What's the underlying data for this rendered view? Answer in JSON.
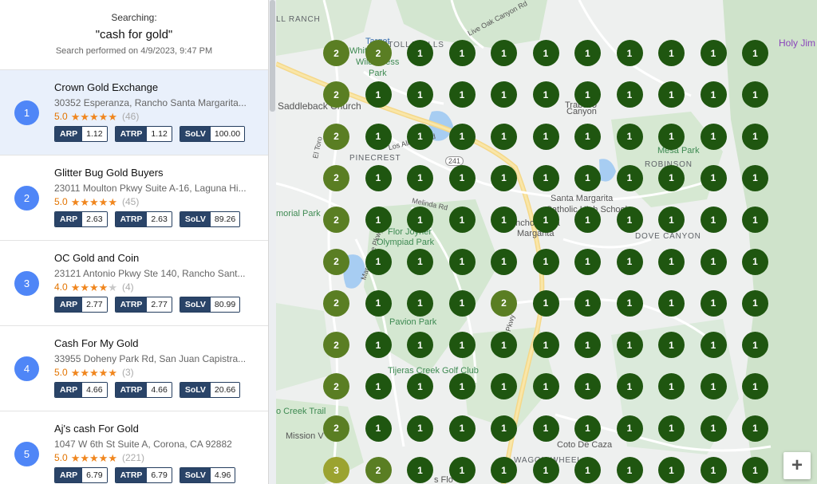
{
  "search": {
    "label": "Searching:",
    "query": "\"cash for gold\"",
    "performed": "Search performed on 4/9/2023, 9:47 PM"
  },
  "results": [
    {
      "rank": "1",
      "name": "Crown Gold Exchange",
      "address": "30352 Esperanza, Rancho Santa Margarita...",
      "rating": "5.0",
      "stars": 5,
      "reviews": "(46)",
      "arp": "1.12",
      "atrp": "1.12",
      "solv": "100.00",
      "selected": true
    },
    {
      "rank": "2",
      "name": "Glitter Bug Gold Buyers",
      "address": "23011 Moulton Pkwy Suite A-16, Laguna Hi...",
      "rating": "5.0",
      "stars": 5,
      "reviews": "(45)",
      "arp": "2.63",
      "atrp": "2.63",
      "solv": "89.26",
      "selected": false
    },
    {
      "rank": "3",
      "name": "OC Gold and Coin",
      "address": "23121 Antonio Pkwy Ste 140, Rancho Sant...",
      "rating": "4.0",
      "stars": 4,
      "reviews": "(4)",
      "arp": "2.77",
      "atrp": "2.77",
      "solv": "80.99",
      "selected": false
    },
    {
      "rank": "4",
      "name": "Cash For My Gold",
      "address": "33955 Doheny Park Rd, San Juan Capistra...",
      "rating": "5.0",
      "stars": 5,
      "reviews": "(3)",
      "arp": "4.66",
      "atrp": "4.66",
      "solv": "20.66",
      "selected": false
    },
    {
      "rank": "5",
      "name": "Aj's cash For Gold",
      "address": "1047 W 6th St Suite A, Corona, CA 92882",
      "rating": "5.0",
      "stars": 5,
      "reviews": "(221)",
      "arp": "6.79",
      "atrp": "6.79",
      "solv": "4.96",
      "selected": false
    }
  ],
  "metric_labels": {
    "arp": "ARP",
    "atrp": "ATRP",
    "solv": "SoLV"
  },
  "map": {
    "labels": {
      "ranch": "LL RANCH",
      "target": "Target",
      "whiting": "Whiting",
      "wilderness": "Wilderness",
      "park": "Park",
      "saddleback": "Saddleback Church",
      "pinecrest": "PINECREST",
      "trabuco": "Trabuco",
      "canyon": "Canyon",
      "mesa_park": "Mesa Park",
      "robinson": "ROBINSON",
      "santa_margarita": "Santa Margarita",
      "catholic": "Catholic High School",
      "rancho_santa": "ancho Santa",
      "margarita": "Margarita",
      "memorial_park": "morial Park",
      "flor_joyner": "Flor Joyner",
      "olympiad": "Olympiad Park",
      "dove_canyon": "DOVE CANYON",
      "pavion": "Pavion Park",
      "tijeras": "Tijeras Creek Golf Club",
      "creek_trail": "o Creek Trail",
      "mission": "Mission V",
      "coto": "Coto De Caza",
      "wagon": "WAGON WHEEL",
      "holy_jim": "Holy Jim",
      "live_oak": "Live Oak Canyon Rd",
      "road_241": "241",
      "los_alisos": "Los Alisos Blvd",
      "melinda": "Melinda Rd",
      "marguerite": "Marguerite Pkwy",
      "antonio": "Antonio Pkwy",
      "el_toro": "El Toro",
      "tortolla": "ORTOLLA HILLS",
      "florence": "s Flo"
    },
    "grid_rows": [
      [
        "2",
        "2",
        "1",
        "1",
        "1",
        "1",
        "1",
        "1",
        "1",
        "1",
        "1"
      ],
      [
        "2",
        "1",
        "1",
        "1",
        "1",
        "1",
        "1",
        "1",
        "1",
        "1",
        "1"
      ],
      [
        "2",
        "1",
        "1",
        "1",
        "1",
        "1",
        "1",
        "1",
        "1",
        "1",
        "1"
      ],
      [
        "2",
        "1",
        "1",
        "1",
        "1",
        "1",
        "1",
        "1",
        "1",
        "1",
        "1"
      ],
      [
        "2",
        "1",
        "1",
        "1",
        "1",
        "1",
        "1",
        "1",
        "1",
        "1",
        "1"
      ],
      [
        "2",
        "1",
        "1",
        "1",
        "1",
        "1",
        "1",
        "1",
        "1",
        "1",
        "1"
      ],
      [
        "2",
        "1",
        "1",
        "1",
        "2",
        "1",
        "1",
        "1",
        "1",
        "1",
        "1"
      ],
      [
        "2",
        "1",
        "1",
        "1",
        "1",
        "1",
        "1",
        "1",
        "1",
        "1",
        "1"
      ],
      [
        "2",
        "1",
        "1",
        "1",
        "1",
        "1",
        "1",
        "1",
        "1",
        "1",
        "1"
      ],
      [
        "2",
        "1",
        "1",
        "1",
        "1",
        "1",
        "1",
        "1",
        "1",
        "1",
        "1"
      ],
      [
        "3",
        "2",
        "1",
        "1",
        "1",
        "1",
        "1",
        "1",
        "1",
        "1",
        "1"
      ]
    ],
    "zoom_in_label": "+",
    "colors": {
      "rank1": "#1f5610",
      "rank2": "#5a7e23",
      "rank3": "#9ba330",
      "rank_badge": "#4f86f7"
    }
  }
}
